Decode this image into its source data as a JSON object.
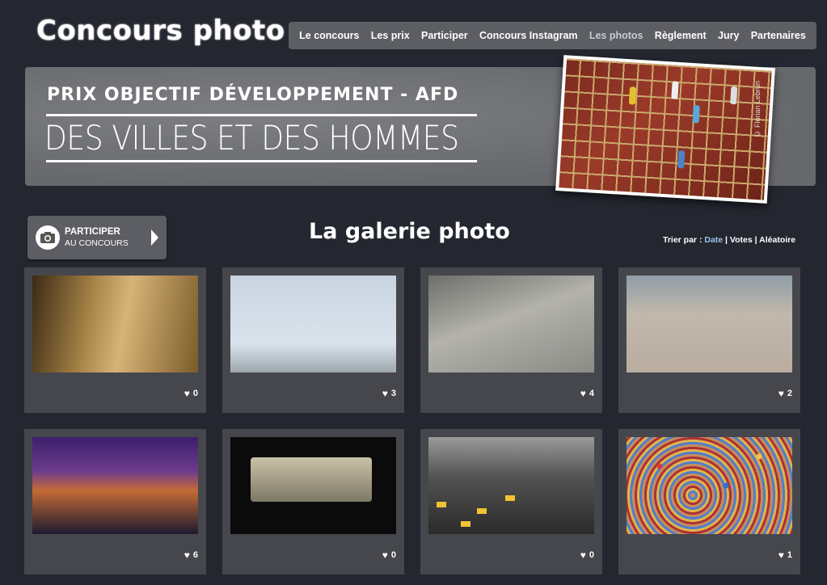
{
  "site": {
    "title": "Concours photo"
  },
  "nav": {
    "items": [
      {
        "label": "Le concours",
        "active": false
      },
      {
        "label": "Les prix",
        "active": false
      },
      {
        "label": "Participer",
        "active": false
      },
      {
        "label": "Concours Instagram",
        "active": false
      },
      {
        "label": "Les photos",
        "active": true
      },
      {
        "label": "Règlement",
        "active": false
      },
      {
        "label": "Jury",
        "active": false
      },
      {
        "label": "Partenaires",
        "active": false
      }
    ]
  },
  "banner": {
    "kicker": "PRIX OBJECTIF DÉVELOPPEMENT - AFD",
    "headline": "DES VILLES ET DES HOMMES",
    "photo_credit": "© Florian Lebrun"
  },
  "cta": {
    "line1": "PARTICIPER",
    "line2": "AU CONCOURS",
    "icon": "camera-icon"
  },
  "gallery": {
    "title": "La galerie photo",
    "sort": {
      "label": "Trier par :",
      "options": [
        "Date",
        "Votes",
        "Aléatoire"
      ],
      "separator": "|",
      "active": "Date"
    },
    "cards": [
      {
        "likes": "0"
      },
      {
        "likes": "3"
      },
      {
        "likes": "4"
      },
      {
        "likes": "2"
      },
      {
        "likes": "6"
      },
      {
        "likes": "0"
      },
      {
        "likes": "0"
      },
      {
        "likes": "1"
      }
    ]
  },
  "colors": {
    "background": "#242730",
    "panel": "#5c5e63",
    "card": "#45474d",
    "active_sort": "#9ec1e6"
  }
}
